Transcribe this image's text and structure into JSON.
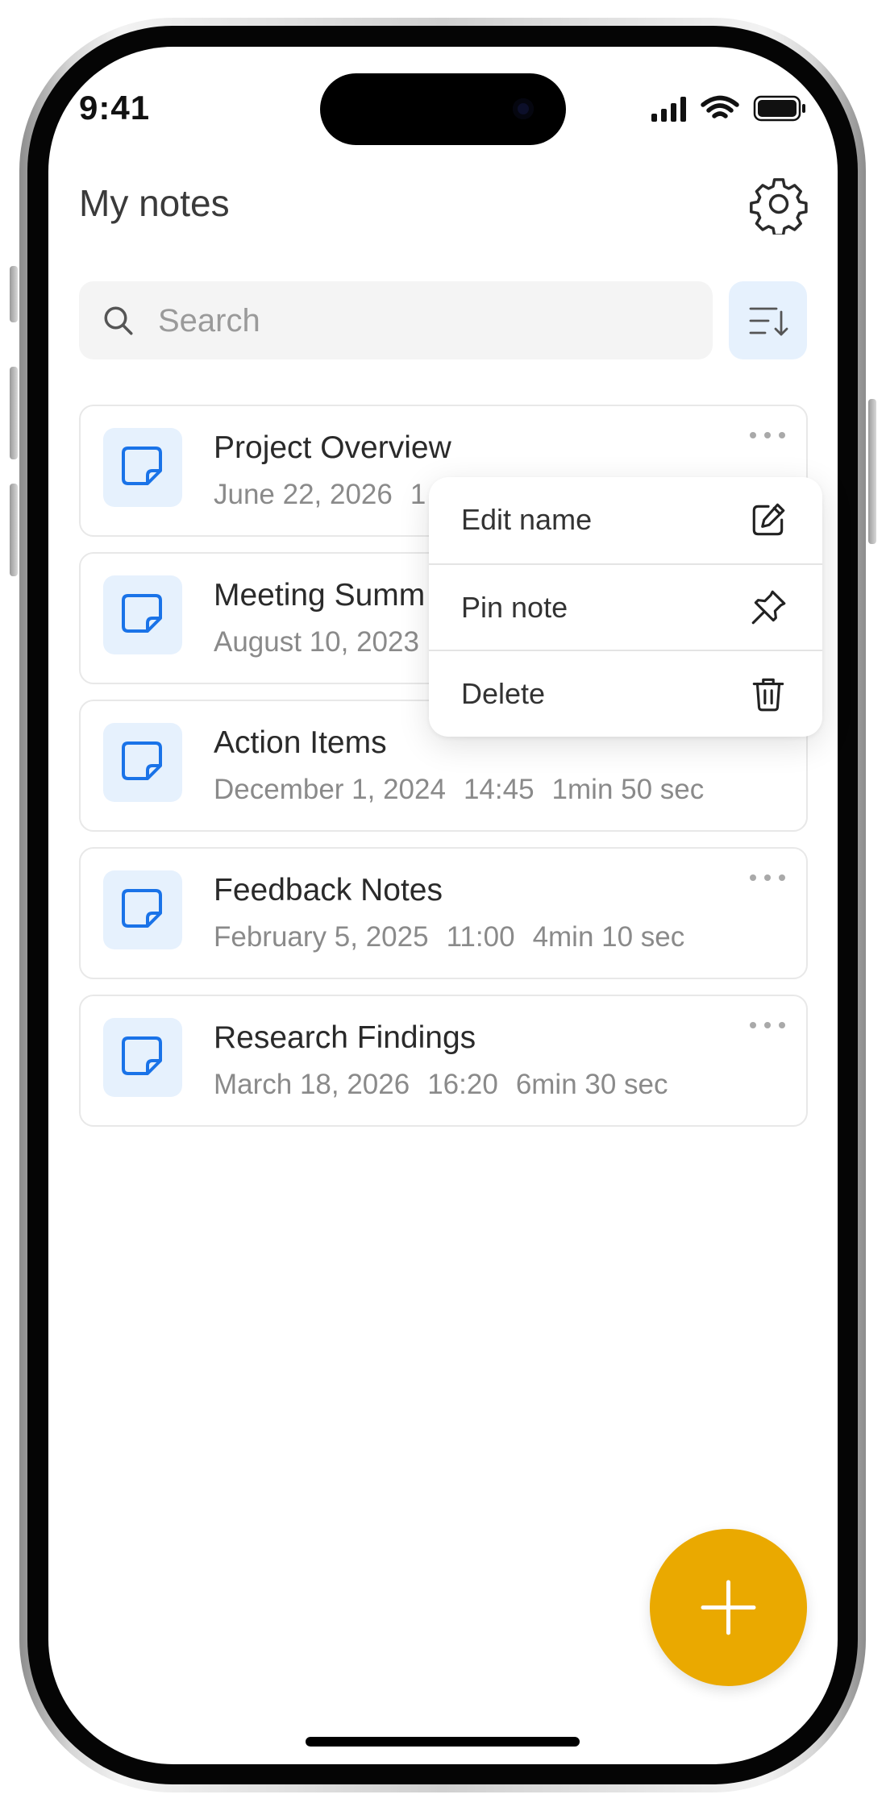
{
  "status_bar": {
    "time": "9:41"
  },
  "header": {
    "title": "My notes"
  },
  "search": {
    "placeholder": "Search",
    "value": ""
  },
  "notes": [
    {
      "title": "Project Overview",
      "date": "June 22, 2026",
      "time": "1",
      "duration": ""
    },
    {
      "title": "Meeting Summ",
      "date": "August 10, 2023",
      "time": "",
      "duration": ""
    },
    {
      "title": "Action Items",
      "date": "December 1, 2024",
      "time": "14:45",
      "duration": "1min 50 sec"
    },
    {
      "title": "Feedback Notes",
      "date": "February 5, 2025",
      "time": "11:00",
      "duration": "4min 10 sec"
    },
    {
      "title": "Research Findings",
      "date": "March 18, 2026",
      "time": "16:20",
      "duration": "6min 30 sec"
    }
  ],
  "context_menu": {
    "items": [
      {
        "label": "Edit name",
        "icon": "edit-icon"
      },
      {
        "label": "Pin note",
        "icon": "pin-icon"
      },
      {
        "label": "Delete",
        "icon": "trash-icon"
      }
    ]
  },
  "colors": {
    "accent_blue": "#1a73e8",
    "icon_bg": "#e6f1fd",
    "fab": "#eaa900",
    "search_bg": "#f4f4f4"
  }
}
